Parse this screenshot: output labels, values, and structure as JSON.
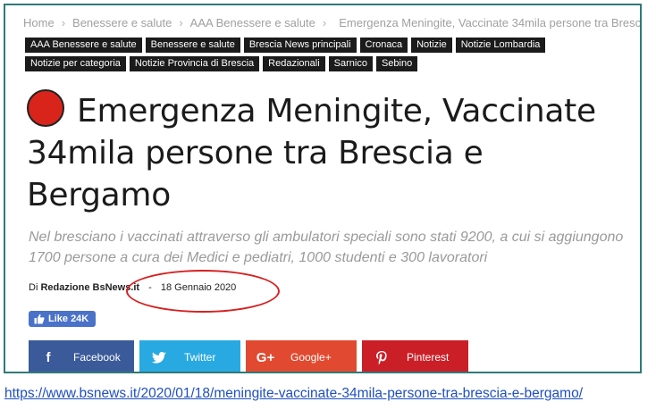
{
  "breadcrumb": {
    "home": "Home",
    "level1": "Benessere e salute",
    "level2": "AAA Benessere e salute",
    "current": "Emergenza Meningite, Vaccinate 34mila persone tra Bresci"
  },
  "tags": [
    "AAA Benessere e salute",
    "Benessere e salute",
    "Brescia News principali",
    "Cronaca",
    "Notizie",
    "Notizie Lombardia",
    "Notizie per categoria",
    "Notizie Provincia di Brescia",
    "Redazionali",
    "Sarnico",
    "Sebino"
  ],
  "article": {
    "title": "Emergenza Meningite, Vaccinate 34mila persone tra Brescia e Bergamo",
    "subtitle": "Nel bresciano i vaccinati attraverso gli ambulatori speciali sono stati 9200, a cui si aggiungono 1700 persone a cura dei Medici e pediatri, 1000 studenti e 300 lavoratori",
    "byline_prefix": "Di",
    "author": "Redazione BsNews.it",
    "separator": "-",
    "date": "18 Gennaio 2020"
  },
  "like": {
    "label": "Like 24K"
  },
  "share": {
    "facebook": "Facebook",
    "twitter": "Twitter",
    "googleplus": "Google+",
    "googleplus_icon": "G+",
    "pinterest": "Pinterest"
  },
  "caption_url": "https://www.bsnews.it/2020/01/18/meningite-vaccinate-34mila-persone-tra-brescia-e-bergamo/",
  "colors": {
    "frame": "#2f7a78",
    "red_dot": "#d9241b",
    "facebook": "#3b5a9a",
    "twitter": "#29a9e1",
    "googleplus": "#e14a30",
    "pinterest": "#cb1f27",
    "like": "#4a72c8",
    "annotation": "#d62020"
  }
}
